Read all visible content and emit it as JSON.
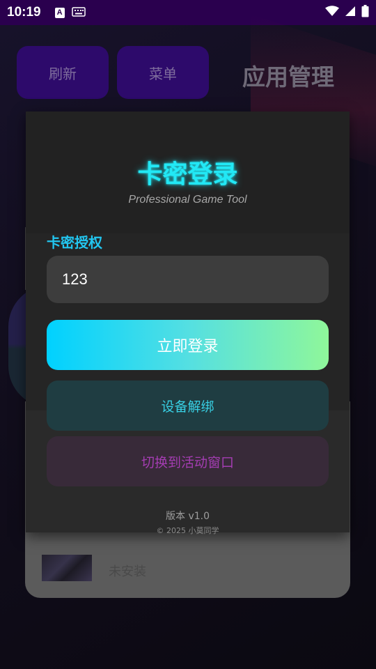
{
  "status_bar": {
    "time": "10:19",
    "notification_icon_letter": "A",
    "icons": [
      "keyboard-icon",
      "wifi-icon",
      "cellular-signal-icon",
      "battery-icon"
    ]
  },
  "background_app": {
    "refresh_label": "刷新",
    "menu_label": "菜单",
    "title": "应用管理",
    "app_status": "未安装"
  },
  "login_dialog": {
    "title": "卡密登录",
    "subtitle": "Professional Game Tool",
    "field_label": "卡密授权",
    "card_key_value": "123",
    "login_button": "立即登录",
    "unbind_button": "设备解绑",
    "switch_button": "切换到活动窗口",
    "version": "版本 v1.0",
    "copyright": "© 2025 小莫同学"
  },
  "colors": {
    "status_bar_bg": "#2a004e",
    "title_cyan": "#22e8f5",
    "login_gradient_start": "#00d1ff",
    "login_gradient_end": "#8ff79a",
    "unbind_bg": "#1f3d42",
    "switch_bg": "#382a39",
    "switch_text": "#a43db2"
  }
}
